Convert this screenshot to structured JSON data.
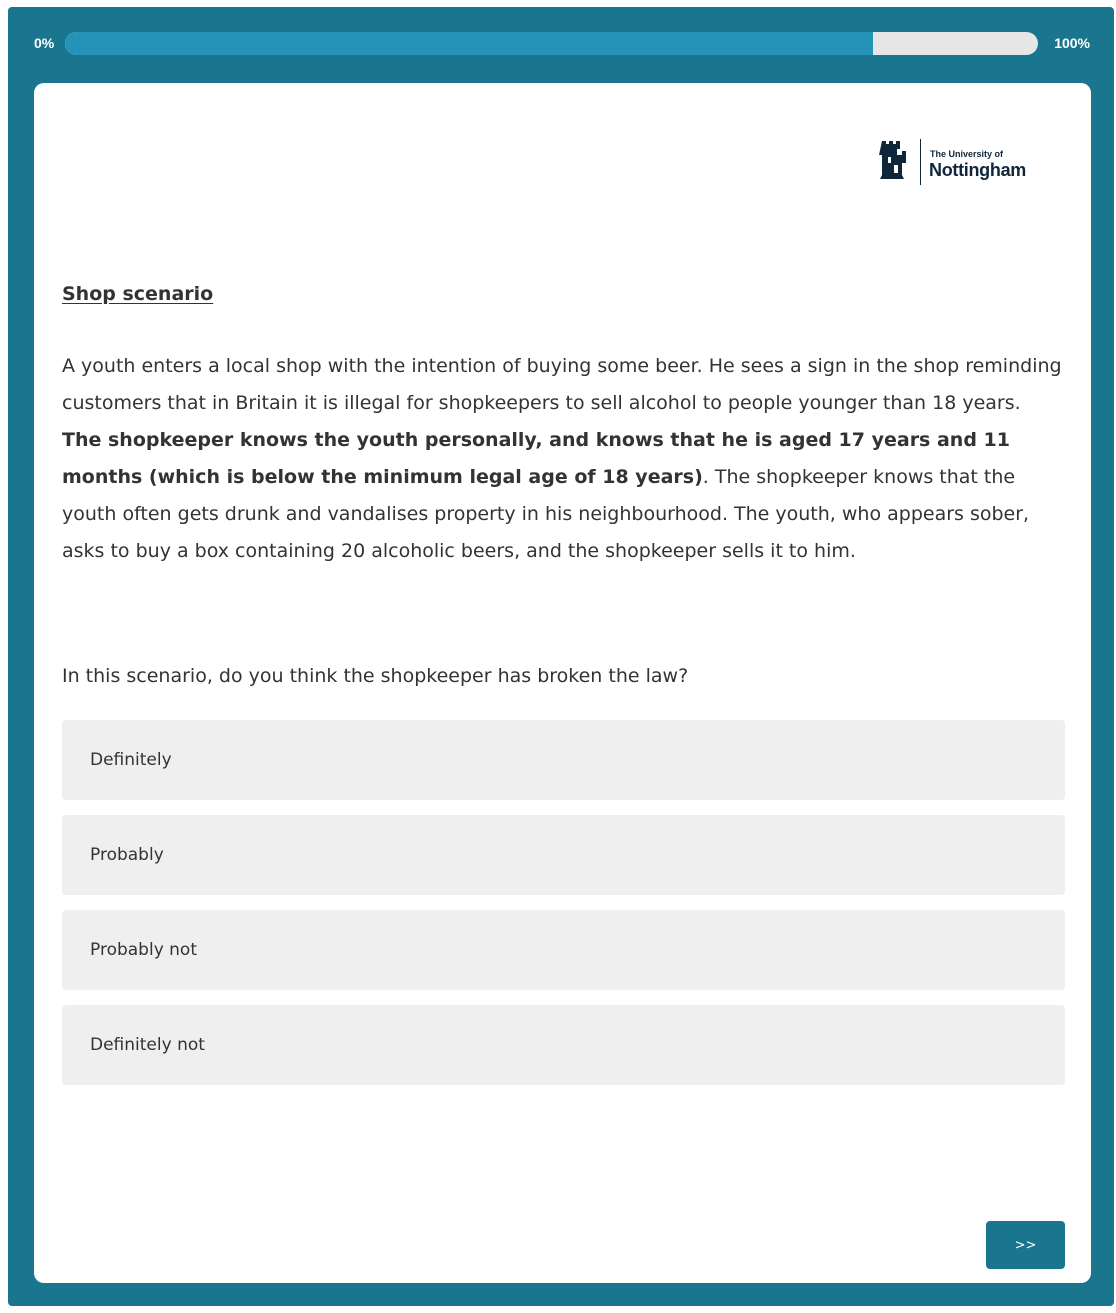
{
  "progress": {
    "start_label": "0%",
    "end_label": "100%",
    "value_percent": 83
  },
  "logo": {
    "line1": "The University of",
    "line2": "Nottingham"
  },
  "heading": "Shop scenario",
  "scenario": {
    "part1": "A youth enters a local shop with the intention of buying some beer. He sees a sign in the shop reminding customers that in Britain it is illegal for shopkeepers to sell alcohol to people younger than 18 years. ",
    "bold": "The shopkeeper knows the youth personally, and knows that he is aged 17 years and 11 months (which is below the minimum legal age of 18 years)",
    "part2": ". The shopkeeper knows that the youth often gets drunk and vandalises property in his neighbourhood. The youth, who appears sober, asks to buy a box containing 20 alcoholic beers, and the shopkeeper sells it to him."
  },
  "question": "In this scenario, do you think the shopkeeper has broken the law?",
  "options": [
    "Definitely",
    "Probably",
    "Probably not",
    "Definitely not"
  ],
  "next_button": ">>",
  "colors": {
    "frame": "#1a768f",
    "progress_fill": "#2593b8",
    "progress_track": "#e6e6e6",
    "option_bg": "#efefef",
    "text": "#333333"
  }
}
